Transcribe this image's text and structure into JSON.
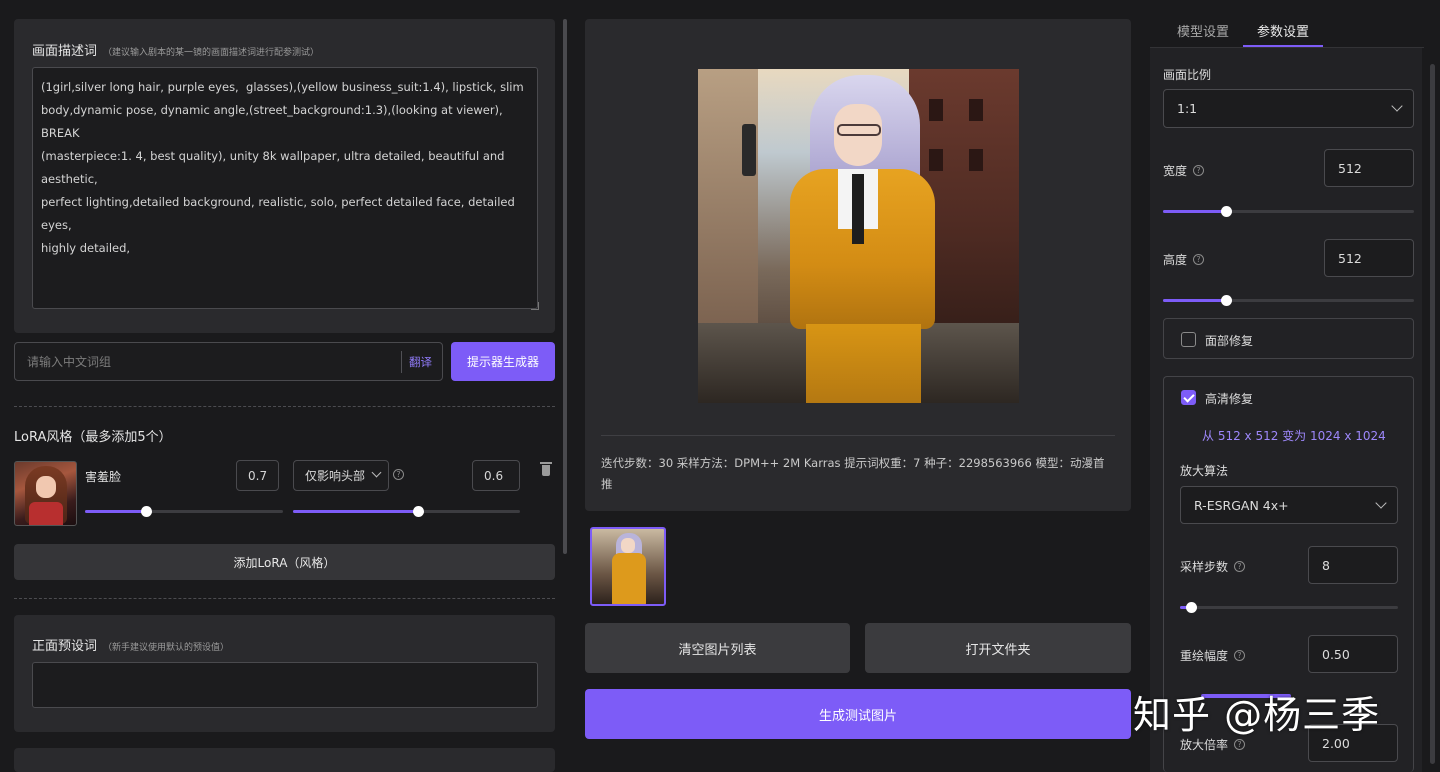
{
  "left": {
    "prompt": {
      "title": "画面描述词",
      "hint": "（建议输入剧本的某一镜的画面描述词进行配参测试）",
      "text": "(1girl,silver long hair, purple eyes,  glasses),(yellow business_suit:1.4), lipstick, slim\nbody,dynamic pose, dynamic angle,(street_background:1.3),(looking at viewer),\nBREAK\n(masterpiece:1. 4, best quality), unity 8k wallpaper, ultra detailed, beautiful and aesthetic,\nperfect lighting,detailed background, realistic, solo, perfect detailed face, detailed eyes,\nhighly detailed,"
    },
    "zh_input": {
      "placeholder": "请输入中文词组",
      "translate_label": "翻译"
    },
    "prompt_generator_label": "提示器生成器",
    "lora": {
      "title": "LoRA风格（最多添加5个）",
      "item": {
        "name": "害羞脸",
        "weight": "0.7",
        "mode": "仅影响头部",
        "mode_weight": "0.6",
        "weight_slider": 0.31,
        "mode_slider": 0.55
      },
      "add_label": "添加LoRA（风格）"
    },
    "positive_preset": {
      "title": "正面预设词",
      "hint": "（新手建议使用默认的预设值）",
      "text": ""
    }
  },
  "center": {
    "gen_info": "迭代步数：30  采样方法：DPM++ 2M Karras  提示词权重：7  种子：2298563966  模型：动漫首推",
    "clear_label": "清空图片列表",
    "open_folder_label": "打开文件夹",
    "generate_label": "生成测试图片"
  },
  "right": {
    "tabs": [
      {
        "label": "模型设置",
        "active": false
      },
      {
        "label": "参数设置",
        "active": true
      }
    ],
    "ratio": {
      "label": "画面比例",
      "value": "1:1"
    },
    "width": {
      "label": "宽度",
      "value": "512",
      "slider": 0.25
    },
    "height": {
      "label": "高度",
      "value": "512",
      "slider": 0.25
    },
    "face_fix": {
      "label": "面部修复",
      "checked": false
    },
    "hires_fix": {
      "label": "高清修复",
      "checked": true,
      "info": "从 512 x 512 变为 1024 x 1024",
      "upscaler": {
        "label": "放大算法",
        "value": "R-ESRGAN 4x+"
      },
      "steps": {
        "label": "采样步数",
        "value": "8",
        "slider": 0.05
      },
      "denoise": {
        "label": "重绘幅度",
        "value": "0.50"
      },
      "scale": {
        "label": "放大倍率",
        "value": "2.00"
      }
    }
  },
  "watermark": "知乎 @杨三季",
  "colors": {
    "accent": "#7d5cf7",
    "panel": "#2a2a2d",
    "background": "#1a1a1c",
    "input": "#1c1c1e"
  }
}
